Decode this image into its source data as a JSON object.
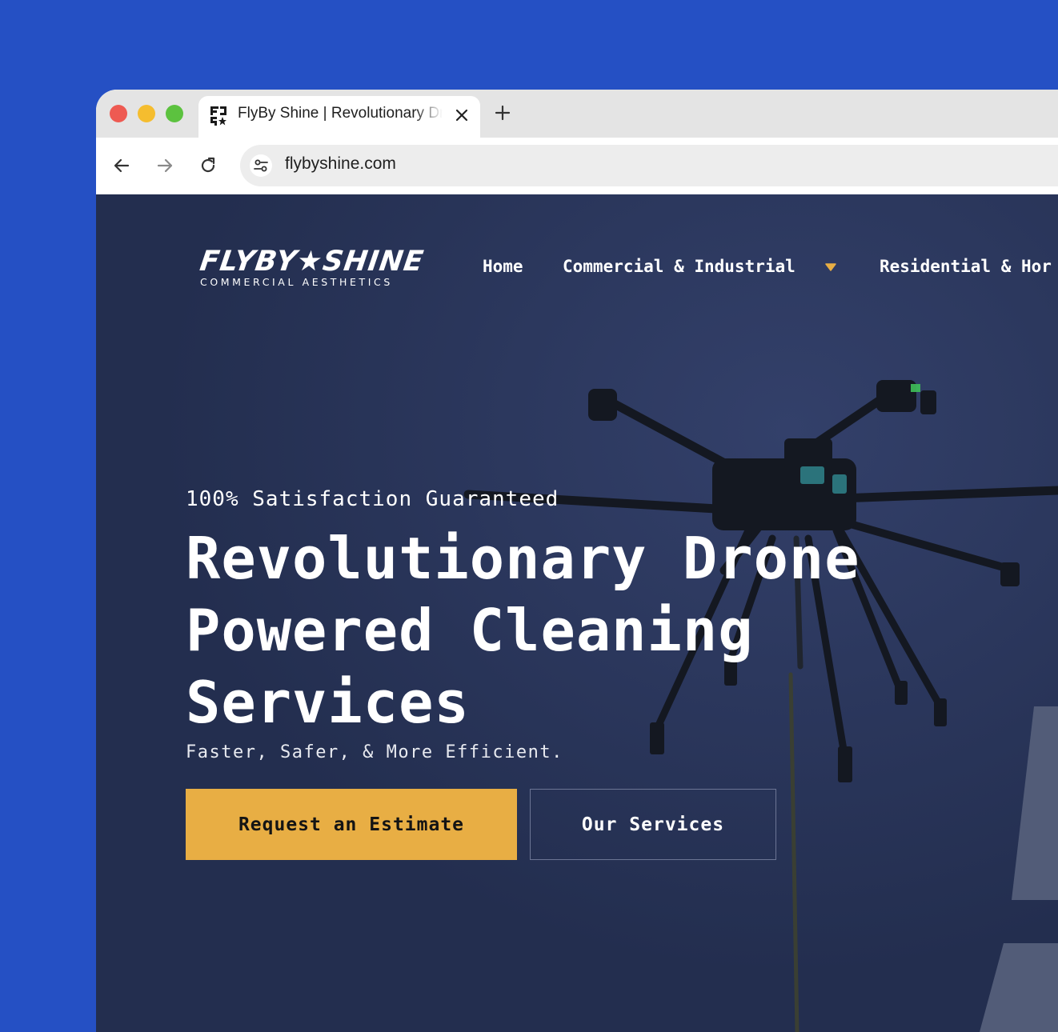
{
  "colors": {
    "backdrop": "#2550c4",
    "page_background": "#232e4f",
    "accent": "#e8ae44",
    "text": "#ffffff"
  },
  "browser": {
    "tab": {
      "favicon": "flyby-shine-logo-icon",
      "title": "FlyBy Shine | Revolutionary Drone Powered Cleaning Services",
      "close_icon": "close-icon"
    },
    "new_tab_icon": "plus-icon",
    "nav": {
      "back_icon": "arrow-left-icon",
      "forward_icon": "arrow-right-icon",
      "reload_icon": "reload-icon"
    },
    "address_bar": {
      "site_info_icon": "tune-icon",
      "url": "flybyshine.com"
    }
  },
  "site": {
    "logo": {
      "wordmark": "FLYBY★SHINE",
      "tagline": "COMMERCIAL AESTHETICS"
    },
    "nav": [
      {
        "label": "Home"
      },
      {
        "label": "Commercial & Industrial",
        "has_dropdown": true
      },
      {
        "label": "Residential & Hor"
      }
    ],
    "hero": {
      "eyebrow": "100% Satisfaction Guaranteed",
      "headline": "Revolutionary Drone Powered Cleaning Services",
      "subheadline": "Faster, Safer, & More Efficient.",
      "primary_cta": "Request an Estimate",
      "secondary_cta": "Our Services",
      "background_image": "cleaning-drone-photo"
    }
  }
}
